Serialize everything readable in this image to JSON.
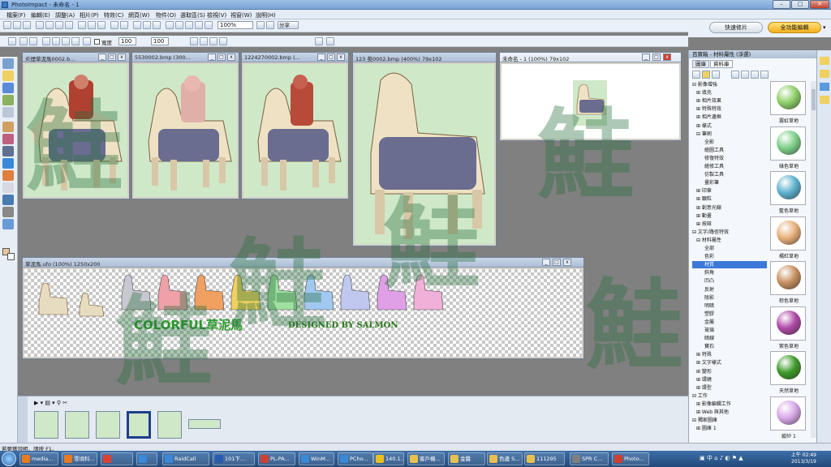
{
  "app": {
    "title": "PhotoImpact - 未命名 - 1"
  },
  "menu": [
    "檔案(F)",
    "編輯(E)",
    "調整(A)",
    "相片(P)",
    "特效(C)",
    "網頁(W)",
    "物件(O)",
    "選取區(S)",
    "檢視(V)",
    "視窗(W)",
    "說明(H)"
  ],
  "toolbar": {
    "zoom": "100%",
    "share": "分享",
    "border_label": "寬度",
    "val1": "100",
    "val2": "100"
  },
  "right_buttons": {
    "quick": "快速修片",
    "full": "全功能編輯"
  },
  "windows": [
    {
      "title": "炎煙草泥馬0002.b..."
    },
    {
      "title": "5530002.bmp (300..."
    },
    {
      "title": "1224270002.bmp (..."
    },
    {
      "title": "123 萸0002.bmp (400%) 79x102"
    },
    {
      "title": "未命名 - 1 (100%) 79x102"
    },
    {
      "title": "草泥馬.ufo (100%) 1250x200"
    }
  ],
  "banner": {
    "colorful": "COLORFUL",
    "chinese": "草泥馬",
    "designed": "DESIGNED BY SALMON"
  },
  "watermark": "鮭",
  "panel": {
    "title": "百寶箱 - 材料屬性 (淨選)",
    "tabs": [
      "圖庫",
      "資料庫"
    ],
    "tree": [
      {
        "t": "⊟ 影像增強",
        "l": 0
      },
      {
        "t": "⊞ 填充",
        "l": 1
      },
      {
        "t": "⊞ 相片效果",
        "l": 1
      },
      {
        "t": "⊞ 特殊特效",
        "l": 1
      },
      {
        "t": "⊞ 相片邊框",
        "l": 1
      },
      {
        "t": "⊞ 樣式",
        "l": 1
      },
      {
        "t": "⊟ 筆刷",
        "l": 1
      },
      {
        "t": "全影",
        "l": 3
      },
      {
        "t": "繪圖工具",
        "l": 3
      },
      {
        "t": "修復特效",
        "l": 3
      },
      {
        "t": "繪修工具",
        "l": 3
      },
      {
        "t": "仿製工具",
        "l": 3
      },
      {
        "t": "畫彩筆",
        "l": 3
      },
      {
        "t": "⊞ 印章",
        "l": 1
      },
      {
        "t": "⊞ 顆粒",
        "l": 1
      },
      {
        "t": "⊞ 創意光線",
        "l": 1
      },
      {
        "t": "⊞ 動畫",
        "l": 1
      },
      {
        "t": "⊞ 按鈕",
        "l": 1
      },
      {
        "t": "⊟ 文字/路徑特效",
        "l": 0
      },
      {
        "t": "⊟ 材料屬性",
        "l": 1
      },
      {
        "t": "全部",
        "l": 3
      },
      {
        "t": "色彩",
        "l": 3
      },
      {
        "t": "材質",
        "l": 3,
        "sel": true
      },
      {
        "t": "斜角",
        "l": 3
      },
      {
        "t": "凹凸",
        "l": 3
      },
      {
        "t": "反射",
        "l": 3
      },
      {
        "t": "陰影",
        "l": 3
      },
      {
        "t": "明暗",
        "l": 3
      },
      {
        "t": "塑膠",
        "l": 3
      },
      {
        "t": "金屬",
        "l": 3
      },
      {
        "t": "玻璃",
        "l": 3
      },
      {
        "t": "暗線",
        "l": 3
      },
      {
        "t": "寶石",
        "l": 3
      },
      {
        "t": "⊞ 特殊",
        "l": 1
      },
      {
        "t": "⊞ 文字樣式",
        "l": 1
      },
      {
        "t": "⊞ 變形",
        "l": 1
      },
      {
        "t": "⊞ 環繞",
        "l": 1
      },
      {
        "t": "⊞ 環型",
        "l": 1
      },
      {
        "t": "⊟ 工作",
        "l": 0
      },
      {
        "t": "⊞ 影像編輯工作",
        "l": 1
      },
      {
        "t": "⊞ Web 與其他",
        "l": 1
      },
      {
        "t": "⊟ 獨家圖庫",
        "l": 0
      },
      {
        "t": "⊞ 圖庫 1",
        "l": 1
      }
    ],
    "swatches": [
      {
        "label": "霧虹草地",
        "color": "#8fd06a"
      },
      {
        "label": "綠色草地",
        "color": "#7fd08a"
      },
      {
        "label": "藍色草地",
        "color": "#5fb2d0"
      },
      {
        "label": "橘紅草地",
        "color": "#e8b07a"
      },
      {
        "label": "棕色草地",
        "color": "#c89060"
      },
      {
        "label": "紫色草地",
        "color": "#b04aa8"
      },
      {
        "label": "天然草地",
        "color": "#3f9a2a"
      },
      {
        "label": "縱紗 1",
        "color": "#d8a8e8"
      }
    ]
  },
  "status": "若要獲說明，請按 F1。",
  "taskbar": [
    {
      "label": "media...",
      "color": "#e87a20"
    },
    {
      "label": "雪頃科...",
      "color": "#e87a20"
    },
    {
      "label": "",
      "color": "#e04030"
    },
    {
      "label": "",
      "color": "#3a88d8"
    },
    {
      "label": "RaidCall",
      "color": "#3a88d8"
    },
    {
      "label": "101下...",
      "color": "#2a5ab0"
    },
    {
      "label": "PL-PA...",
      "color": "#d04030"
    },
    {
      "label": "WinM...",
      "color": "#3a88d8"
    },
    {
      "label": "PCho...",
      "color": "#3a88d8"
    },
    {
      "label": "140.1...",
      "color": "#e8c020"
    },
    {
      "label": "客戶機...",
      "color": "#e8c050"
    },
    {
      "label": "金醬",
      "color": "#e8c050"
    },
    {
      "label": "色邊 S...",
      "color": "#e8c050"
    },
    {
      "label": "111295",
      "color": "#e8c050"
    },
    {
      "label": "SPR C...",
      "color": "#808080"
    },
    {
      "label": "Photo...",
      "color": "#d04030"
    }
  ],
  "clock": {
    "time": "上午 02:49",
    "date": "2013/3/19"
  }
}
